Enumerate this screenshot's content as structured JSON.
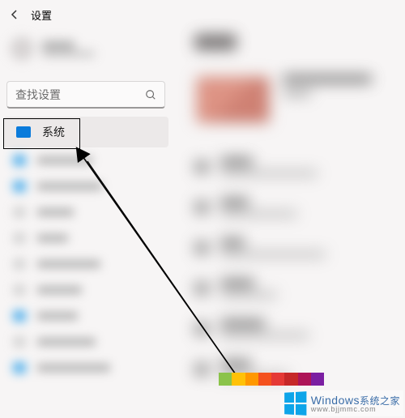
{
  "titlebar": {
    "app_title": "设置"
  },
  "sidebar": {
    "search_placeholder": "查找设置",
    "items": [
      {
        "label": "系统",
        "selected": true
      }
    ]
  },
  "watermark": {
    "brand_top": "Windows",
    "brand_suffix": "系统之家",
    "url": "www.bjjmmc.com"
  },
  "gradient_colors": [
    "#8bc34a",
    "#ffc107",
    "#ff9800",
    "#f4511e",
    "#e53935",
    "#c62828",
    "#ad1457",
    "#7b1fa2"
  ]
}
